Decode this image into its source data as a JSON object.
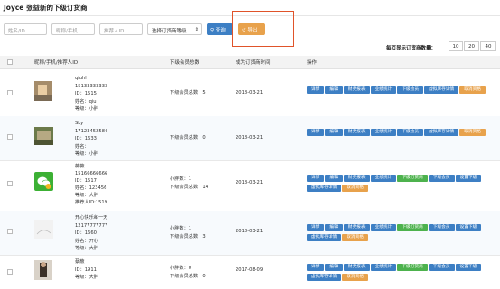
{
  "page": {
    "title": "Joyce 张益新的下级订货商"
  },
  "filters": {
    "name_placeholder": "姓名/ID",
    "nick_placeholder": "昵称/手机",
    "referrer_placeholder": "推荐人ID",
    "level_select": "选择订货商等级",
    "search_label": "查询",
    "export_label": "导出"
  },
  "pagesize": {
    "label": "每页显示订货商数量：",
    "options": [
      "10",
      "20",
      "40"
    ]
  },
  "columns": {
    "name": "昵称/手机/推荐人ID",
    "sub": "下级会员总数",
    "date": "成为订货商时间",
    "ops": "操作"
  },
  "rows": [
    {
      "line1": "qiuhl",
      "line2": "15133333333",
      "line3": "ID：1515",
      "line4": "姓名：qiu",
      "line5": "等级：小胖",
      "sub1": "下级会员总数：5",
      "sub2": "",
      "date": "2018-03-21",
      "ops": [
        "详情",
        "编辑",
        "财务报表",
        "业绩统计",
        "下级会员",
        "虚拟库存详情",
        "取消资格"
      ]
    },
    {
      "line1": "Sky",
      "line2": "17123452584",
      "line3": "ID：1633",
      "line4": "姓名：",
      "line5": "等级：小胖",
      "sub1": "下级会员总数：0",
      "sub2": "",
      "date": "2018-03-21",
      "ops": [
        "详情",
        "编辑",
        "财务报表",
        "业绩统计",
        "下级会员",
        "虚拟库存详情",
        "取消资格"
      ]
    },
    {
      "line1": "薇薇",
      "line2": "15166666666",
      "line3": "ID：1517",
      "line4": "姓名：123456",
      "line5": "等级：大胖",
      "line6": "推荐人ID:1519",
      "sub1": "小胖数：1",
      "sub2": "下级会员总数：14",
      "date": "2018-03-21",
      "ops": [
        "详情",
        "编辑",
        "财务报表",
        "业绩统计",
        "下级订货商",
        "下级会员",
        "设置下级",
        "虚拟库存详情",
        "取消资格"
      ]
    },
    {
      "line1": "开心快乐每一天",
      "line2": "12177777777",
      "line3": "ID：1660",
      "line4": "姓名：开心",
      "line5": "等级：大胖",
      "sub1": "小胖数：1",
      "sub2": "下级会员总数：3",
      "date": "2018-03-21",
      "ops": [
        "详情",
        "编辑",
        "财务报表",
        "业绩统计",
        "下级订货商",
        "下级会员",
        "设置下级",
        "虚拟库存详情",
        "取消资格"
      ]
    },
    {
      "line1": "蔡蔽",
      "line2": "",
      "line3": "ID：1911",
      "line4": "等级：大胖",
      "line5": "",
      "sub1": "小胖数：0",
      "sub2": "下级会员总数：0",
      "date": "2017-08-09",
      "ops": [
        "详情",
        "编辑",
        "财务报表",
        "业绩统计",
        "下级订货商",
        "下级会员",
        "设置下级",
        "虚拟库存详情",
        "取消资格"
      ]
    }
  ]
}
